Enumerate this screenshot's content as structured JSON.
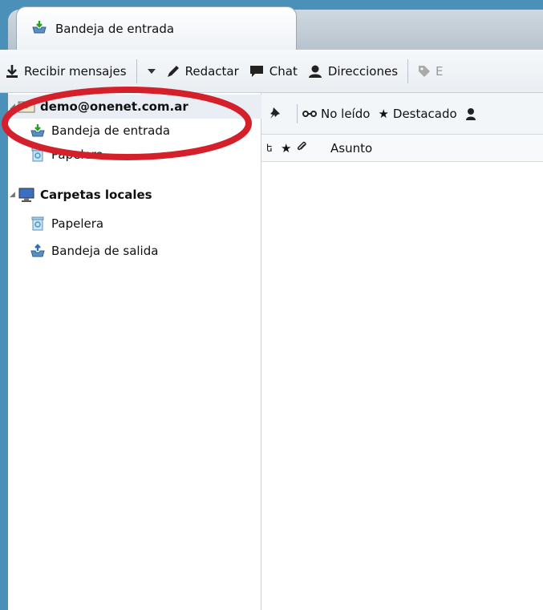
{
  "tab": {
    "title": "Bandeja de entrada"
  },
  "toolbar": {
    "get_messages": "Recibir mensajes",
    "compose": "Redactar",
    "chat": "Chat",
    "address_book": "Direcciones",
    "tag_partial": "E"
  },
  "folders": {
    "account": "demo@onenet.com.ar",
    "account_inbox": "Bandeja de entrada",
    "account_trash": "Papelera",
    "local": "Carpetas locales",
    "local_trash": "Papelera",
    "local_outbox": "Bandeja de salida"
  },
  "quickfilter": {
    "unread": "No leído",
    "starred": "Destacado"
  },
  "columns": {
    "subject": "Asunto"
  },
  "colors": {
    "window_frame": "#4a90b8",
    "annotation_red": "#d4202a"
  }
}
